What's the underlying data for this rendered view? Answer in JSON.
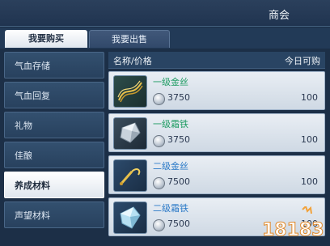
{
  "header": {
    "title": "商会"
  },
  "tabs": [
    {
      "label": "我要购买",
      "active": true
    },
    {
      "label": "我要出售",
      "active": false
    }
  ],
  "sidebar": {
    "items": [
      {
        "label": "气血存储"
      },
      {
        "label": "气血回复"
      },
      {
        "label": "礼物"
      },
      {
        "label": "佳酿"
      },
      {
        "label": "养成材料",
        "active": true
      },
      {
        "label": "声望材料"
      }
    ]
  },
  "list": {
    "col_name": "名称/价格",
    "col_limit": "今日可购",
    "rows": [
      {
        "name": "一级金丝",
        "price": "3750",
        "limit": "100",
        "name_color": "#1f9c63",
        "icon": "gold-silk-icon"
      },
      {
        "name": "一级霜铁",
        "price": "3750",
        "limit": "100",
        "name_color": "#1f9c63",
        "icon": "frost-iron-icon"
      },
      {
        "name": "二级金丝",
        "price": "7500",
        "limit": "100",
        "name_color": "#2a79c7",
        "icon": "gold-silk-icon"
      },
      {
        "name": "二级霜铁",
        "price": "7500",
        "limit": "100",
        "name_color": "#2a79c7",
        "icon": "frost-iron-icon"
      }
    ]
  },
  "watermark": {
    "text": "18183"
  }
}
